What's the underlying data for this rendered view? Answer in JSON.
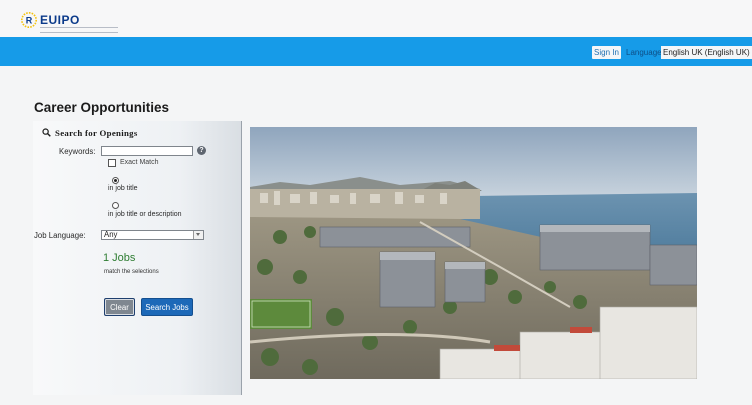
{
  "header": {
    "logo_text": "EUIPO",
    "signin_label": "Sign In",
    "language_label": "Language",
    "language_value": "English UK (English UK) ∨"
  },
  "page": {
    "title": "Career Opportunities"
  },
  "search": {
    "heading": "Search for Openings",
    "keywords_label": "Keywords:",
    "keywords_value": "",
    "help_glyph": "?",
    "exact_match_label": "Exact Match",
    "scope_options": [
      {
        "label": "in job title",
        "selected": true
      },
      {
        "label": "in job title or description",
        "selected": false
      }
    ],
    "job_language_label": "Job Language:",
    "job_language_value": "Any",
    "jobs_count": "1 Jobs",
    "jobs_sub": "match the selections",
    "clear_label": "Clear",
    "search_label": "Search Jobs"
  },
  "colors": {
    "nav_bar": "#169be8",
    "search_button": "#1d69b8",
    "jobs_green": "#2e7d32"
  },
  "icons": {
    "logo": "eu-stars-logo-icon",
    "search": "magnifier-icon",
    "help": "help-icon",
    "dropdown": "chevron-down-icon"
  }
}
